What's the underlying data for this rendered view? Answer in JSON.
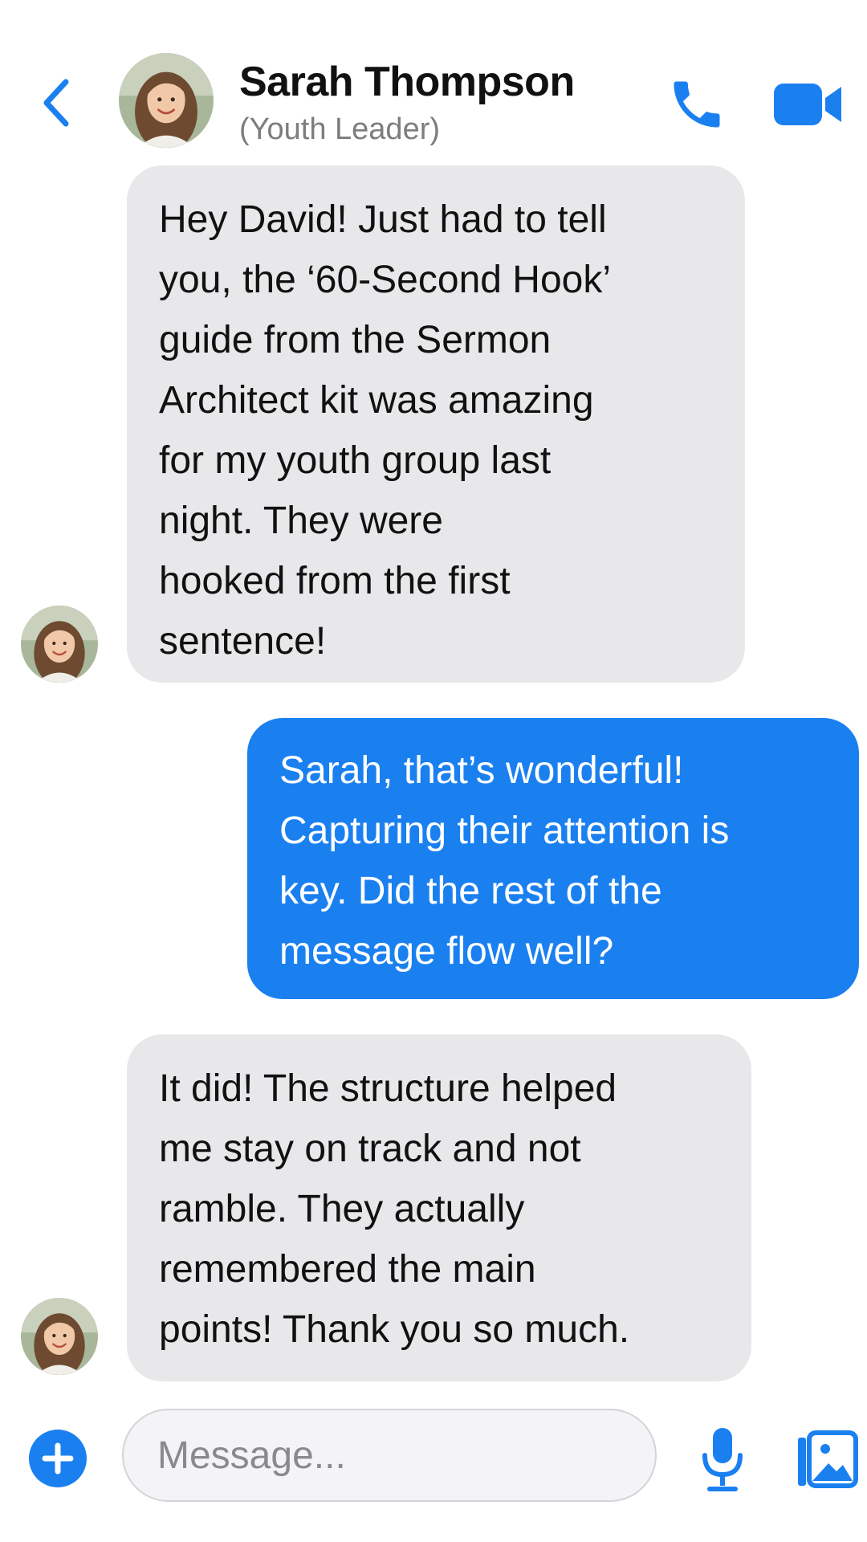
{
  "header": {
    "back_icon": "chevron-left-icon",
    "contact_name": "Sarah Thompson",
    "contact_role": "(Youth Leader)",
    "call_icon": "phone-icon",
    "video_icon": "video-camera-icon"
  },
  "colors": {
    "accent": "#1a80f0",
    "incoming_bubble": "#e8e8ea",
    "outgoing_bubble": "#1a80f0",
    "secondary_text": "#7d7d7d"
  },
  "messages": [
    {
      "direction": "incoming",
      "lines": [
        "Hey David! Just had to tell",
        "you, the ‘60-Second Hook’",
        "guide from the Sermon",
        "Architect kit was amazing",
        "for my youth group last",
        "night. They were",
        "hooked from the first",
        "sentence!"
      ]
    },
    {
      "direction": "outgoing",
      "lines": [
        "Sarah, that’s wonderful!",
        "Capturing their attention is",
        "key. Did the rest of the",
        "message flow well?"
      ]
    },
    {
      "direction": "incoming",
      "lines": [
        "It did! The structure helped",
        "me stay on track and not",
        "ramble. They actually",
        "remembered the main",
        "points! Thank you so much."
      ]
    }
  ],
  "composer": {
    "add_icon": "plus-icon",
    "placeholder": "Message...",
    "value": "",
    "mic_icon": "microphone-icon",
    "gallery_icon": "photo-gallery-icon"
  }
}
